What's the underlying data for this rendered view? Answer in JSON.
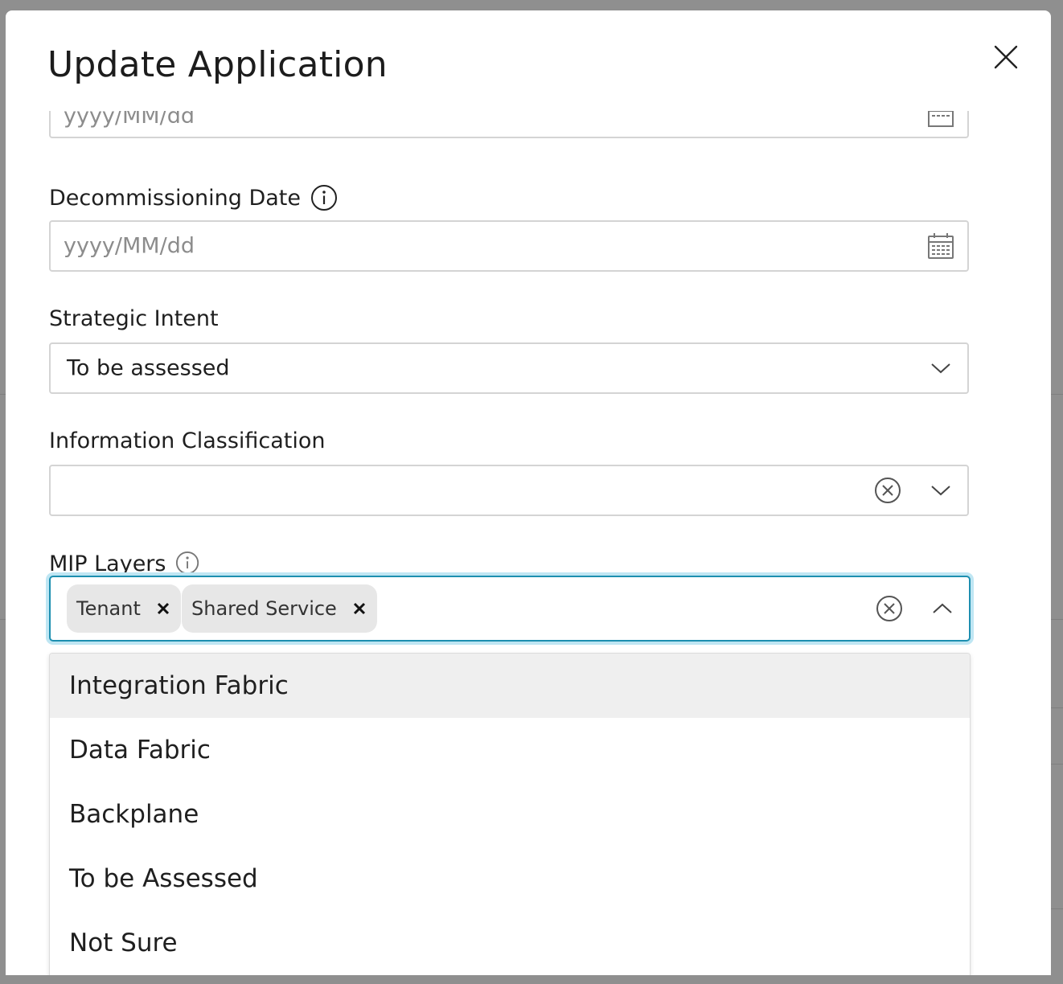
{
  "modal": {
    "title": "Update Application"
  },
  "fields": {
    "prev_date": {
      "placeholder": "yyyy/MM/dd"
    },
    "decommissioning_date": {
      "label": "Decommissioning Date",
      "placeholder": "yyyy/MM/dd"
    },
    "strategic_intent": {
      "label": "Strategic Intent",
      "value": "To be assessed"
    },
    "information_classification": {
      "label": "Information Classification",
      "value": ""
    },
    "mip_layers": {
      "label": "MIP Layers",
      "selected": [
        "Tenant",
        "Shared Service"
      ],
      "options": [
        "Integration Fabric",
        "Data Fabric",
        "Backplane",
        "To be Assessed",
        "Not Sure"
      ],
      "highlighted_option": "Integration Fabric"
    }
  },
  "colors": {
    "focus_border": "#1d8fb0",
    "focus_glow": "#bfe6f3",
    "tag_bg": "#e7e7e7",
    "highlight_bg": "#efefef"
  }
}
